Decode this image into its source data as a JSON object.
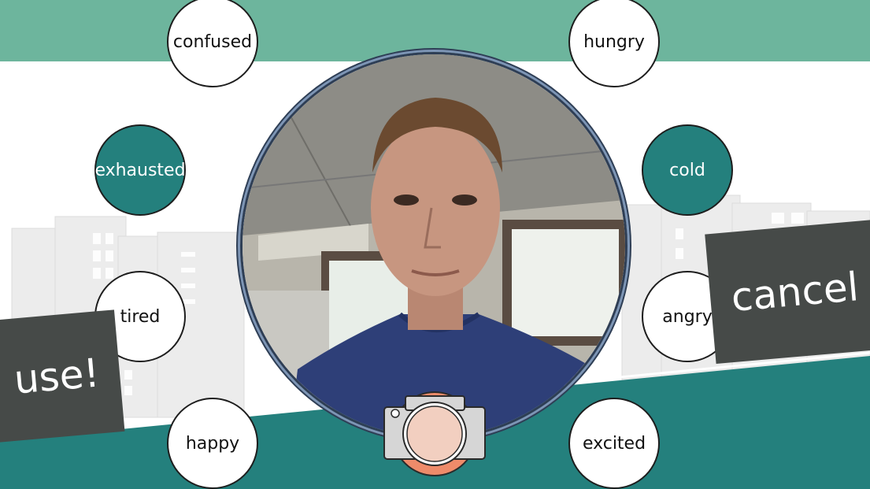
{
  "moods": [
    {
      "id": "confused",
      "label": "confused",
      "selected": false
    },
    {
      "id": "hungry",
      "label": "hungry",
      "selected": false
    },
    {
      "id": "exhausted",
      "label": "exhausted",
      "selected": true
    },
    {
      "id": "cold",
      "label": "cold",
      "selected": true
    },
    {
      "id": "tired",
      "label": "tired",
      "selected": false
    },
    {
      "id": "angry",
      "label": "angry",
      "selected": false
    },
    {
      "id": "happy",
      "label": "happy",
      "selected": false
    },
    {
      "id": "excited",
      "label": "excited",
      "selected": false
    }
  ],
  "buttons": {
    "use": "use!",
    "cancel": "cancel"
  },
  "icons": {
    "capture": "camera-icon"
  },
  "colors": {
    "top_band": "#6db59d",
    "bottom_band": "#24807d",
    "selected_mood": "#24807d",
    "button": "#464a48",
    "camera_ring": "#ee8b6a"
  }
}
